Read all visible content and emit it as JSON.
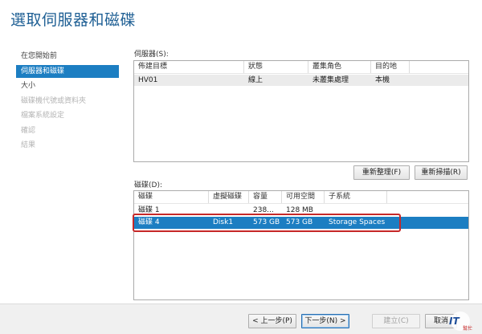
{
  "title": "選取伺服器和磁碟",
  "nav": [
    {
      "label": "在您開始前",
      "state": "normal"
    },
    {
      "label": "伺服器和磁碟",
      "state": "active"
    },
    {
      "label": "大小",
      "state": "normal"
    },
    {
      "label": "磁碟機代號或資料夾",
      "state": "disabled"
    },
    {
      "label": "檔案系統設定",
      "state": "disabled"
    },
    {
      "label": "確認",
      "state": "disabled"
    },
    {
      "label": "結果",
      "state": "disabled"
    }
  ],
  "servers": {
    "label": "伺服器(S):",
    "columns": [
      "佈建目標",
      "狀態",
      "叢集角色",
      "目的地"
    ],
    "rows": [
      {
        "target": "HV01",
        "status": "線上",
        "role": "未叢集處理",
        "dest": "本機"
      }
    ],
    "refresh_button": "重新整理(F)",
    "rescan_button": "重新掃描(R)"
  },
  "disks": {
    "label": "磁碟(D):",
    "columns": [
      "磁碟",
      "虛擬磁碟",
      "容量",
      "可用空間",
      "子系統"
    ],
    "rows": [
      {
        "disk": "磁碟 1",
        "vdisk": "",
        "capacity": "238...",
        "free": "128 MB",
        "subsystem": ""
      },
      {
        "disk": "磁碟 4",
        "vdisk": "Disk1",
        "capacity": "573 GB",
        "free": "573 GB",
        "subsystem": "Storage Spaces"
      }
    ]
  },
  "footer": {
    "prev": "< 上一步(P)",
    "next": "下一步(N) >",
    "create": "建立(C)",
    "cancel": "取消"
  },
  "watermark": {
    "big": "IT",
    "small": "幫忙"
  },
  "colors": {
    "accent": "#1c7ec2",
    "title": "#1e5f94",
    "highlight": "#c62828"
  }
}
